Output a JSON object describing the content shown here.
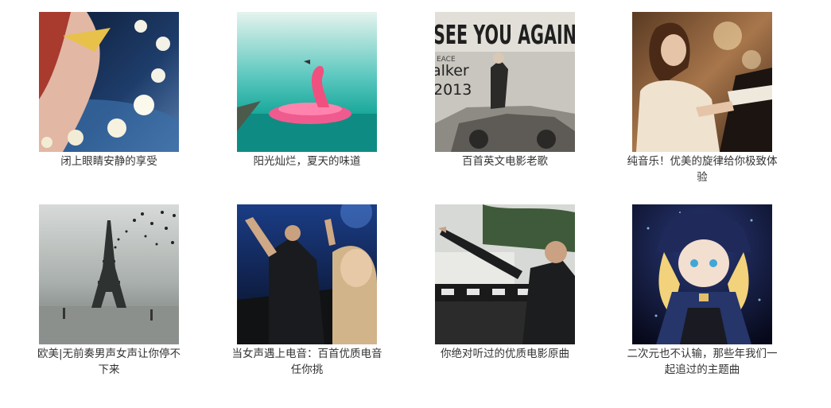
{
  "playlists": [
    {
      "title": "闭上眼睛安静的享受",
      "image": "moon-night-illustration"
    },
    {
      "title": "阳光灿烂，夏天的味道",
      "image": "flamingo-float-photo"
    },
    {
      "title": "百首英文电影老歌",
      "image": "see-you-again-cover",
      "cover_text": "SEE YOU AGAIN",
      "cover_text_2": "alker",
      "cover_text_3": "2013",
      "cover_text_4": "EACE"
    },
    {
      "title": "纯音乐！优美的旋律给你极致体验",
      "image": "piano-girl-photo"
    },
    {
      "title": "欧美|无前奏男声女声让你停不下来",
      "image": "eiffel-tower-birds-photo"
    },
    {
      "title": "当女声遇上电音：百首优质电音任你挑",
      "image": "concert-crowd-photo"
    },
    {
      "title": "你绝对听过的优质电影原曲",
      "image": "man-pointing-photo"
    },
    {
      "title": "二次元也不认输，那些年我们一起追过的主题曲",
      "image": "anime-girl-illustration"
    }
  ],
  "colors": {
    "caption": "#333333",
    "background": "#ffffff"
  }
}
